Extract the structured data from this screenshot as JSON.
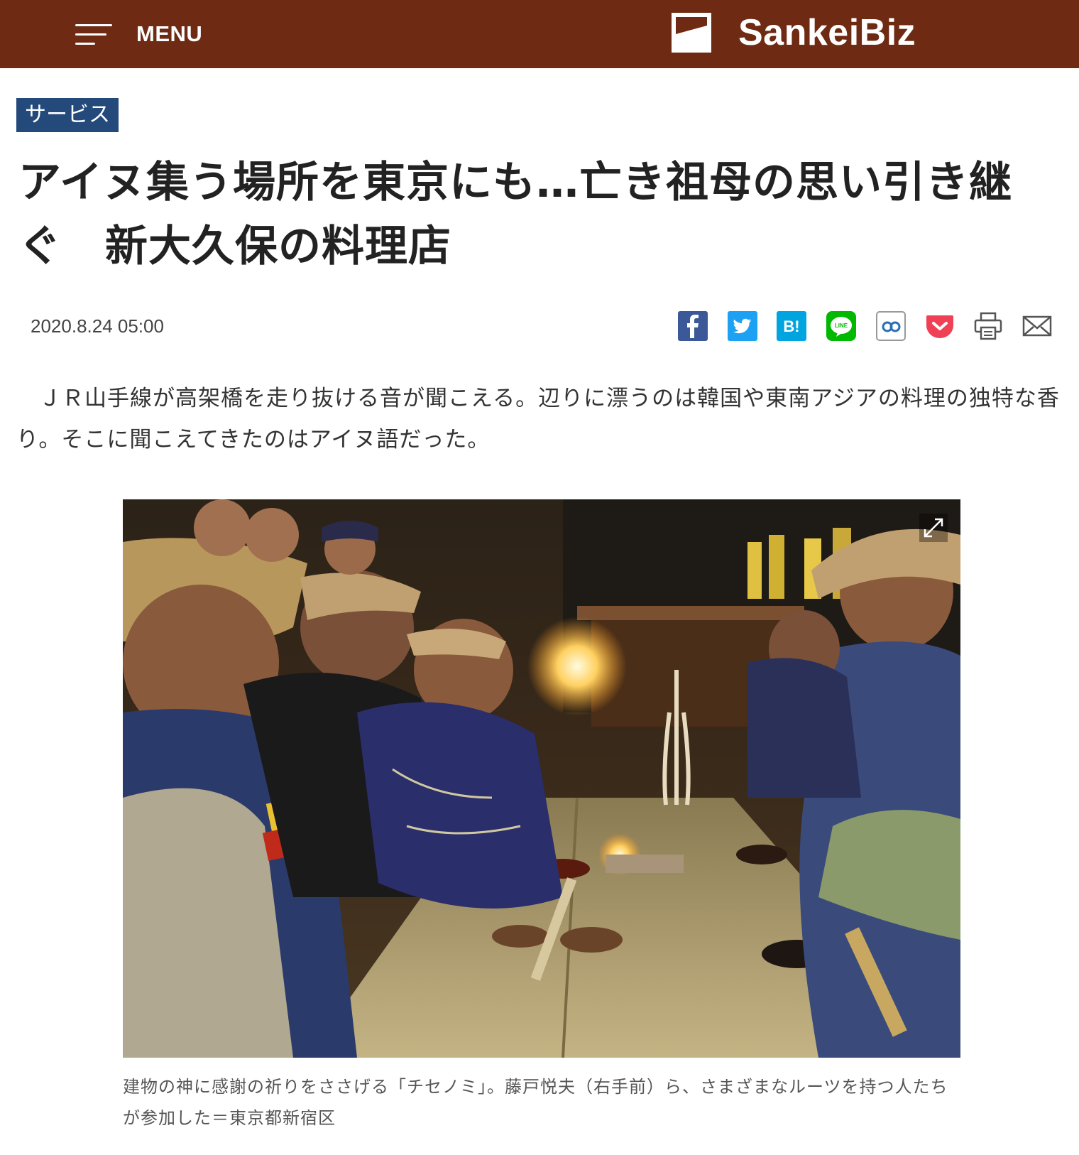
{
  "header": {
    "menu_label": "MENU",
    "logo_text": "SankeiBiz",
    "bar_color": "#6e2a12"
  },
  "article": {
    "category": "サービス",
    "title": "アイヌ集う場所を東京にも…亡き祖母の思い引き継ぐ　新大久保の料理店",
    "date": "2020.8.24 05:00",
    "lead": "　ＪＲ山手線が高架橋を走り抜ける音が聞こえる。辺りに漂うのは韓国や東南アジアの料理の独特な香り。そこに聞こえてきたのはアイヌ語だった。",
    "caption": "建物の神に感謝の祈りをささげる「チセノミ」。藤戸悦夫（右手前）ら、さまざまなルーツを持つ人たちが参加した＝東京都新宿区"
  },
  "share": {
    "icons": [
      "facebook-icon",
      "twitter-icon",
      "hatena-bookmark-icon",
      "line-icon",
      "feedly-icon",
      "pocket-icon",
      "print-icon",
      "mail-icon"
    ],
    "hatena_text": "B!",
    "line_text": "LINE"
  },
  "colors": {
    "category_bg": "#234a7a",
    "facebook": "#3b5998",
    "twitter": "#1da1f2",
    "hatena": "#00a4de",
    "line": "#00b900",
    "pocket": "#ef4056"
  }
}
